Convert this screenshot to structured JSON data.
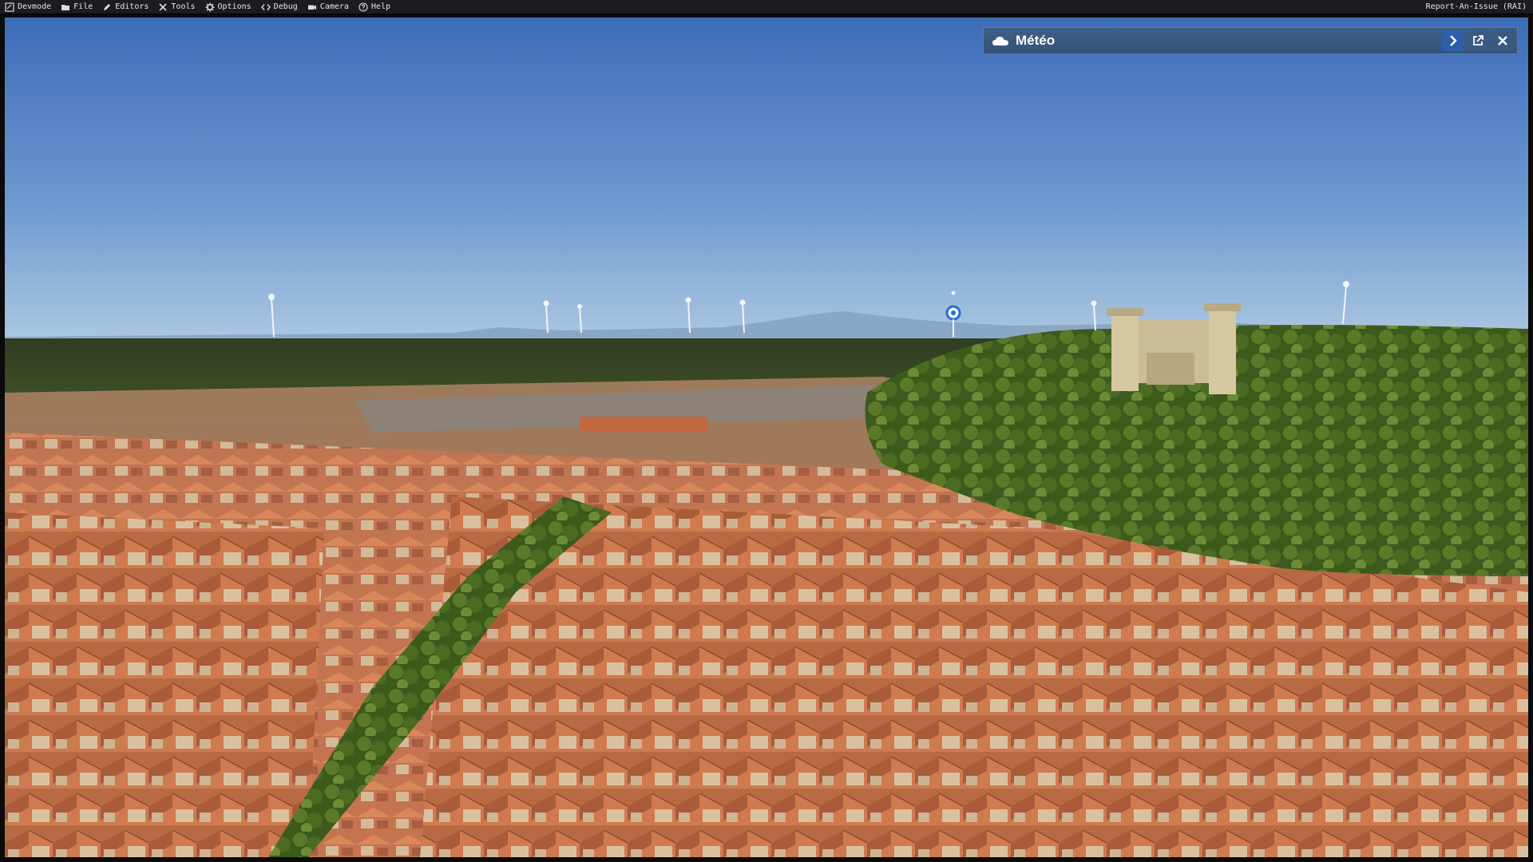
{
  "menubar": {
    "items": [
      {
        "label": "Devmode",
        "icon": "devmode-icon"
      },
      {
        "label": "File",
        "icon": "folder-icon"
      },
      {
        "label": "Editors",
        "icon": "pencil-icon"
      },
      {
        "label": "Tools",
        "icon": "tools-icon"
      },
      {
        "label": "Options",
        "icon": "gear-icon"
      },
      {
        "label": "Debug",
        "icon": "code-icon"
      },
      {
        "label": "Camera",
        "icon": "camera-icon"
      },
      {
        "label": "Help",
        "icon": "help-icon"
      }
    ],
    "right_label": "Report-An-Issue (RAI)"
  },
  "meteo_panel": {
    "title": "Météo",
    "icon": "cloud-icon",
    "buttons": [
      "chevron-right-icon",
      "popout-icon",
      "close-icon"
    ],
    "accent": "#2d5fa8"
  },
  "colors": {
    "sky_top": "#3f6fbb",
    "sky_horizon": "#a9c4de",
    "roof": "#c8693f",
    "vegetation": "#3f5a1e",
    "menubar_bg": "#1a1c1f"
  }
}
